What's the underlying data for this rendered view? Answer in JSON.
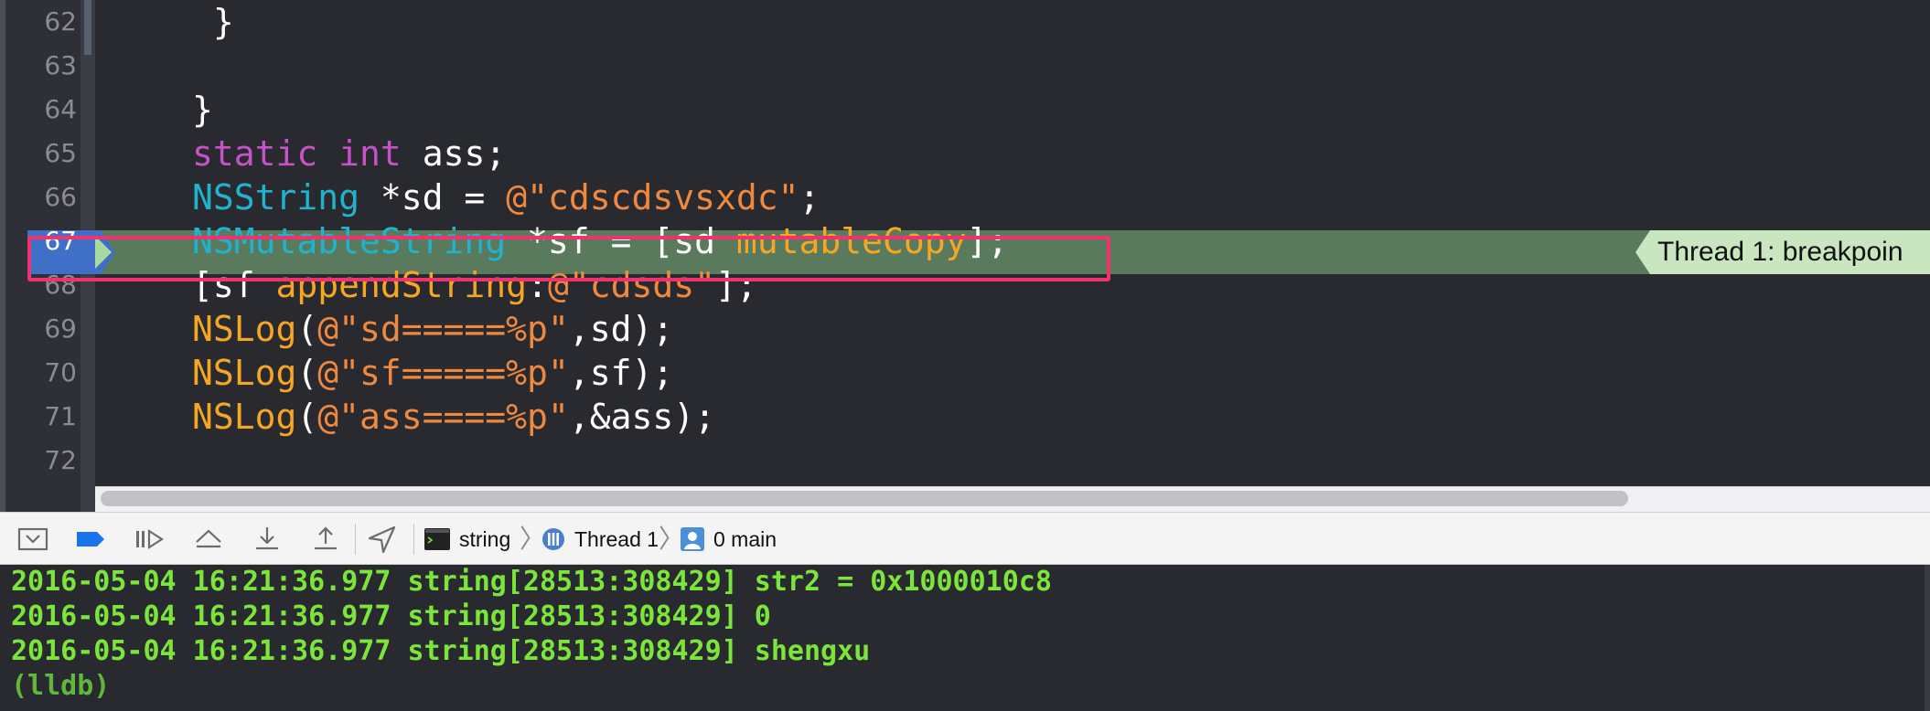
{
  "editor": {
    "lines": [
      {
        "number": "62",
        "tokens": [
          {
            "t": " }",
            "c": "wht"
          }
        ]
      },
      {
        "number": "63",
        "tokens": []
      },
      {
        "number": "64",
        "tokens": [
          {
            "t": "}",
            "c": "wht"
          }
        ]
      },
      {
        "number": "65",
        "tokens": [
          {
            "t": "static",
            "c": "kw"
          },
          {
            "t": " ",
            "c": "wht"
          },
          {
            "t": "int",
            "c": "kw"
          },
          {
            "t": " ass;",
            "c": "wht"
          }
        ]
      },
      {
        "number": "66",
        "tokens": [
          {
            "t": "NSString",
            "c": "cls"
          },
          {
            "t": " *sd = ",
            "c": "wht"
          },
          {
            "t": "@\"cdscdsvsxdc\"",
            "c": "str"
          },
          {
            "t": ";",
            "c": "wht"
          }
        ]
      },
      {
        "number": "67",
        "tokens": [
          {
            "t": "NSMutableString",
            "c": "cls"
          },
          {
            "t": " *sf = [sd ",
            "c": "wht"
          },
          {
            "t": "mutableCopy",
            "c": "msg"
          },
          {
            "t": "];",
            "c": "wht"
          }
        ]
      },
      {
        "number": "68",
        "tokens": [
          {
            "t": "[sf ",
            "c": "wht"
          },
          {
            "t": "appendString",
            "c": "msg"
          },
          {
            "t": ":",
            "c": "wht"
          },
          {
            "t": "@\"cdsds\"",
            "c": "str"
          },
          {
            "t": "];",
            "c": "wht"
          }
        ]
      },
      {
        "number": "69",
        "tokens": [
          {
            "t": "NSLog",
            "c": "msg"
          },
          {
            "t": "(",
            "c": "wht"
          },
          {
            "t": "@\"sd=====%p\"",
            "c": "str"
          },
          {
            "t": ",sd);",
            "c": "wht"
          }
        ]
      },
      {
        "number": "70",
        "tokens": [
          {
            "t": "NSLog",
            "c": "msg"
          },
          {
            "t": "(",
            "c": "wht"
          },
          {
            "t": "@\"sf=====%p\"",
            "c": "str"
          },
          {
            "t": ",sf);",
            "c": "wht"
          }
        ]
      },
      {
        "number": "71",
        "tokens": [
          {
            "t": "NSLog",
            "c": "msg"
          },
          {
            "t": "(",
            "c": "wht"
          },
          {
            "t": "@\"ass====%p\"",
            "c": "str"
          },
          {
            "t": ",&ass);",
            "c": "wht"
          }
        ]
      },
      {
        "number": "72",
        "tokens": []
      }
    ],
    "breakpoint_line": "67",
    "thread_badge": "Thread 1: breakpoin"
  },
  "debug_bar": {
    "buttons": [
      {
        "name": "hide-debug-area-button",
        "icon": "panel-toggle-icon"
      },
      {
        "name": "breakpoints-toggle-button",
        "icon": "breakpoint-icon"
      },
      {
        "name": "continue-button",
        "icon": "continue-icon"
      },
      {
        "name": "step-over-button",
        "icon": "step-over-icon"
      },
      {
        "name": "step-into-button",
        "icon": "step-into-icon"
      },
      {
        "name": "step-out-button",
        "icon": "step-out-icon"
      },
      {
        "name": "simulate-location-button",
        "icon": "location-arrow-icon"
      }
    ],
    "breadcrumb": {
      "process": "string",
      "thread": "Thread 1",
      "frame": "0 main"
    },
    "colors": {
      "breakpoint_active": "#1a73e8"
    }
  },
  "console": {
    "lines": [
      "2016-05-04 16:21:36.977 string[28513:308429] str2 = 0x1000010c8",
      "2016-05-04 16:21:36.977 string[28513:308429] 0",
      "2016-05-04 16:21:36.977 string[28513:308429] shengxu"
    ],
    "prompt": "(lldb)"
  }
}
